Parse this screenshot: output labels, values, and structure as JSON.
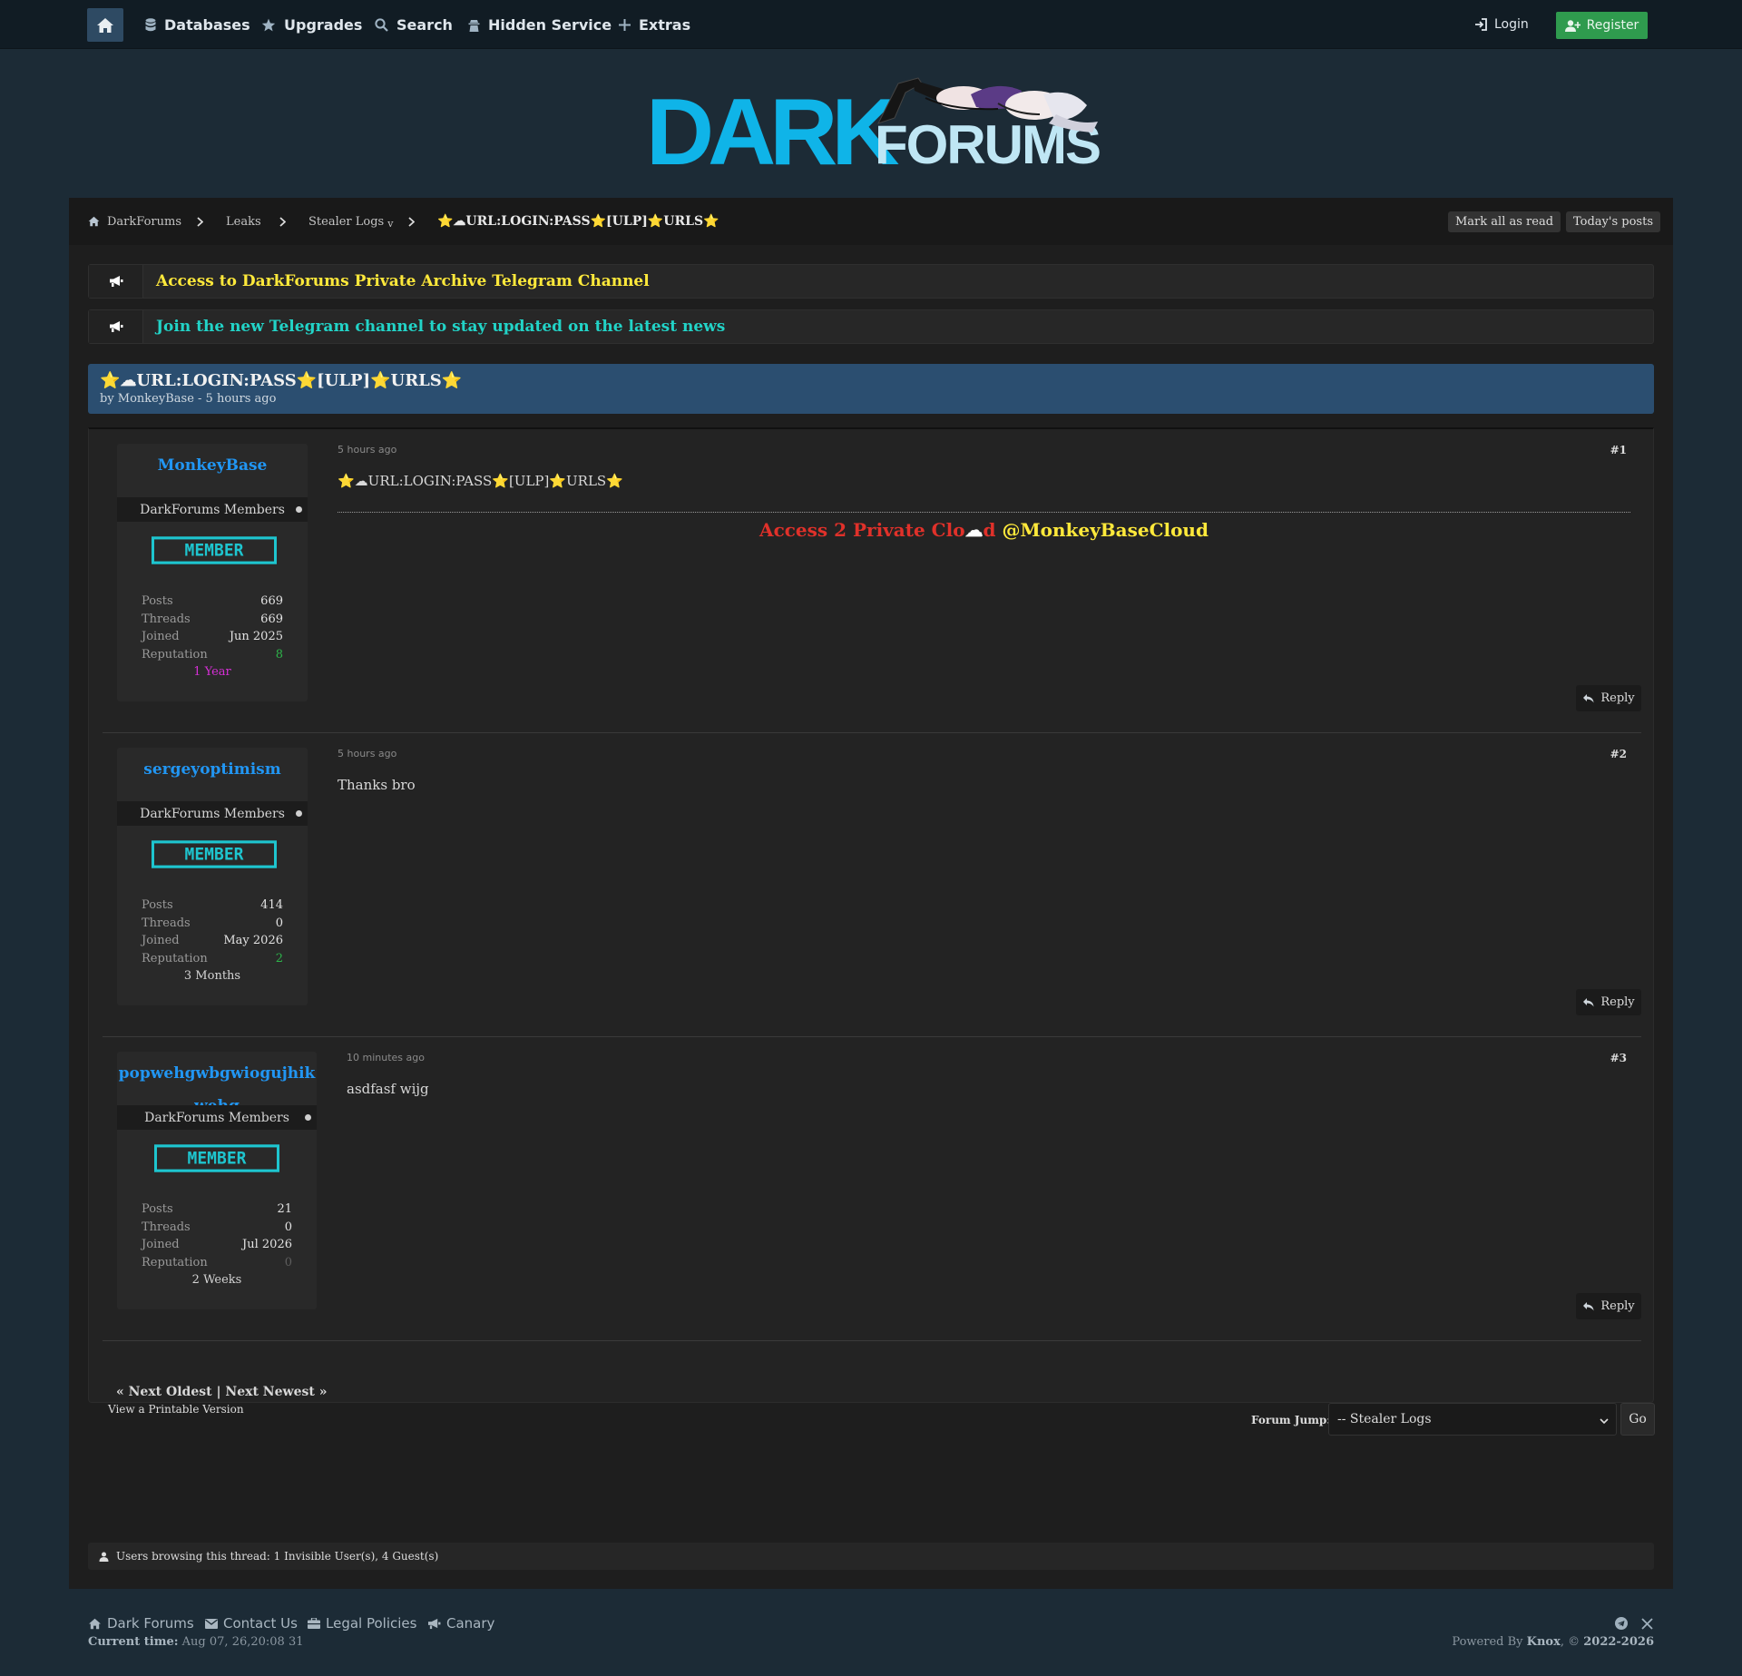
{
  "nav": {
    "home_icon": "home-icon",
    "items": [
      {
        "label": "Databases",
        "icon": "database-icon"
      },
      {
        "label": "Upgrades",
        "icon": "star-icon"
      },
      {
        "label": "Search",
        "icon": "search-icon"
      },
      {
        "label": "Hidden Service",
        "icon": "hidden-service-icon"
      },
      {
        "label": "Extras",
        "icon": "plus-icon"
      }
    ],
    "login": "Login",
    "register": "Register"
  },
  "logo": {
    "dark": "DARK",
    "forums": "FORUMS"
  },
  "breadcrumb": {
    "items": [
      "DarkForums",
      "Leaks",
      "Stealer Logs"
    ],
    "dropdown_marker": "v",
    "current": "⭐☁URL:LOGIN:PASS⭐[ULP]⭐URLS⭐",
    "mark_all_read": "Mark all as read",
    "todays_posts": "Today's posts"
  },
  "announcements": [
    {
      "text": "Access to DarkForums Private Archive Telegram Channel",
      "color": "#ffe93b"
    },
    {
      "text": "Join the new Telegram channel to stay updated on the latest news",
      "color": "#22d3c7"
    }
  ],
  "thread": {
    "title": "⭐☁URL:LOGIN:PASS⭐[ULP]⭐URLS⭐",
    "byline": "by MonkeyBase - 5 hours ago"
  },
  "posts": [
    {
      "username": "MonkeyBase",
      "group": "DarkForums Members",
      "badge": "MEMBER",
      "stats": {
        "posts": "669",
        "threads": "669",
        "joined": "Jun 2025",
        "reputation": "8"
      },
      "age": "1 Year",
      "age_color": "#d62fd6",
      "date": "5 hours ago",
      "number": "#1",
      "body": "⭐☁URL:LOGIN:PASS⭐[ULP]⭐URLS⭐",
      "signature": {
        "red": "Access 2 Private Clo",
        "cloud": "☁",
        "red2": "d",
        "handle": "@MonkeyBaseCloud"
      },
      "reply": "Reply"
    },
    {
      "username": "sergeyoptimism",
      "group": "DarkForums Members",
      "badge": "MEMBER",
      "stats": {
        "posts": "414",
        "threads": "0",
        "joined": "May 2026",
        "reputation": "2"
      },
      "age": "3 Months",
      "age_color": "#d4d4d4",
      "date": "5 hours ago",
      "number": "#2",
      "body": "Thanks bro",
      "reply": "Reply"
    },
    {
      "username": "popwehgwbgwiogujhikwehg",
      "group": "DarkForums Members",
      "badge": "MEMBER",
      "stats": {
        "posts": "21",
        "threads": "0",
        "joined": "Jul 2026",
        "reputation": "0"
      },
      "age": "2 Weeks",
      "age_color": "#d4d4d4",
      "date": "10 minutes ago",
      "number": "#3",
      "body": "asdfasf wijg",
      "reply": "Reply"
    }
  ],
  "stat_labels": {
    "posts": "Posts",
    "threads": "Threads",
    "joined": "Joined",
    "reputation": "Reputation"
  },
  "pager": "« Next Oldest | Next Newest »",
  "printable": "View a Printable Version",
  "forum_jump": {
    "label": "Forum Jump:",
    "selected": "-- Stealer Logs",
    "go": "Go"
  },
  "browsing": "Users browsing this thread: 1 Invisible User(s), 4 Guest(s)",
  "footer": {
    "links": [
      "Dark Forums",
      "Contact Us",
      "Legal Policies",
      "Canary"
    ],
    "time_label": "Current time:",
    "time_value": "Aug 07, 26,20:08 31",
    "powered_prefix": "Powered By",
    "powered_name": "Knox",
    "powered_suffix": ", ©",
    "powered_years": "2022-2026"
  },
  "colors": {
    "accent": "#2196f3",
    "register": "#2f9b4e",
    "thread_header": "#2b4e70",
    "badge": "#1ec5cf"
  }
}
